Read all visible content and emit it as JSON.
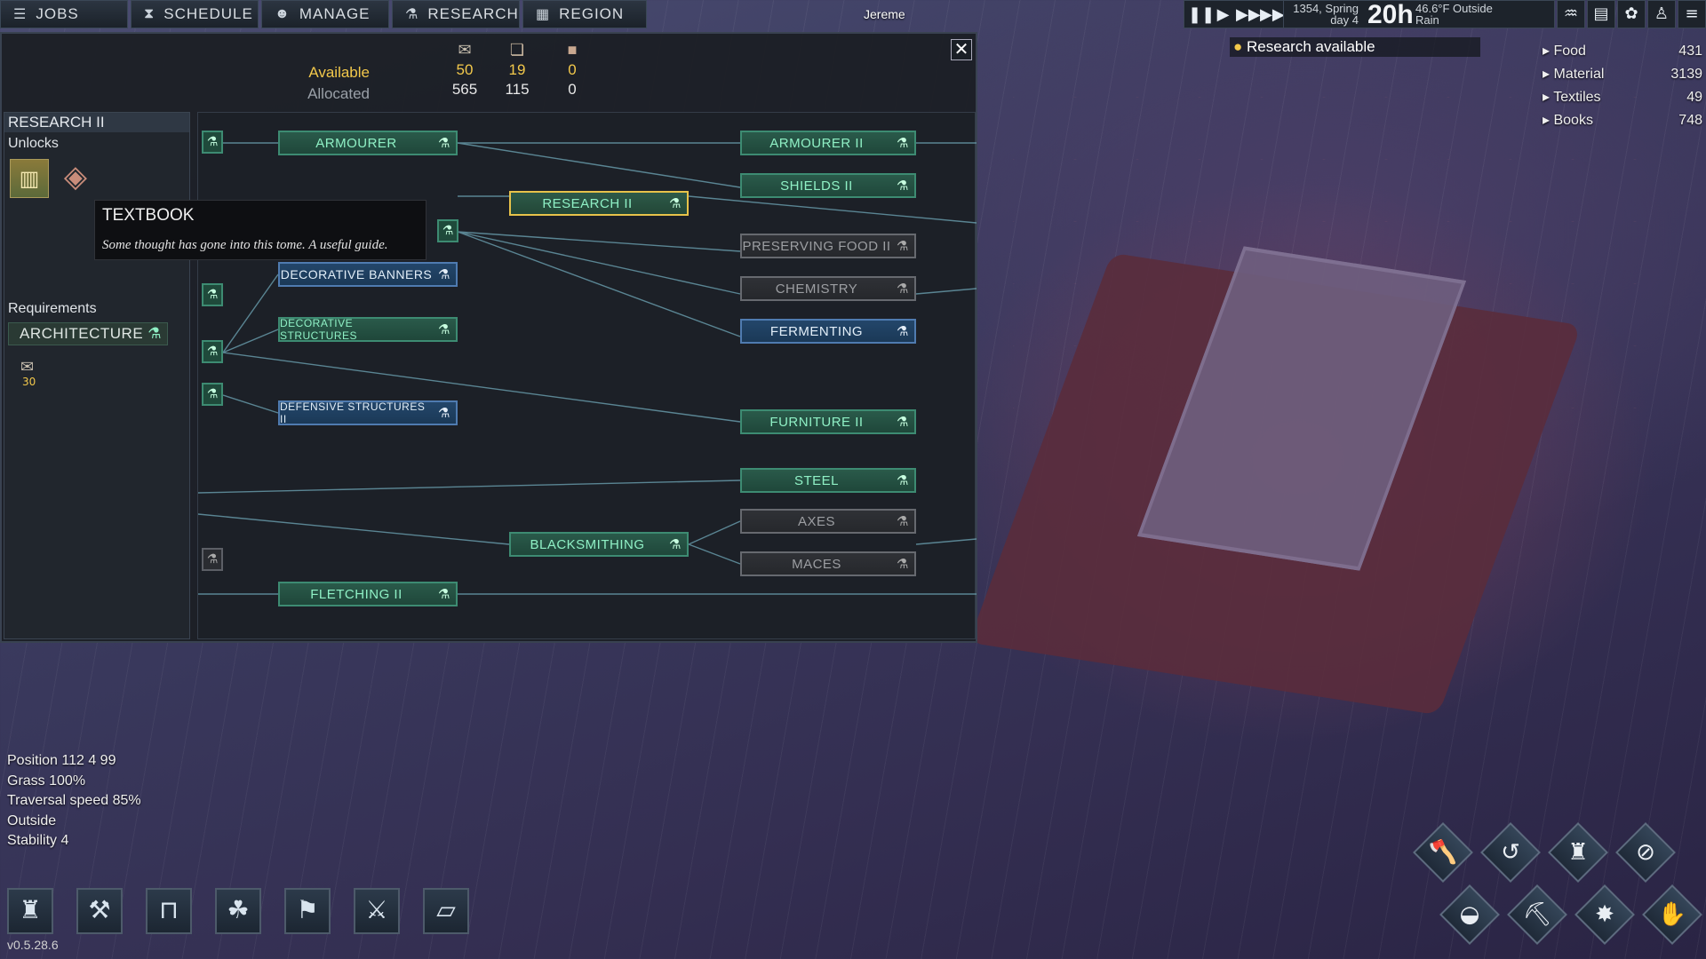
{
  "topbar": {
    "tabs": [
      {
        "label": "JOBS",
        "icon": "list-icon"
      },
      {
        "label": "SCHEDULE",
        "icon": "hourglass-icon"
      },
      {
        "label": "MANAGE",
        "icon": "people-icon"
      },
      {
        "label": "RESEARCH",
        "icon": "flask-icon"
      },
      {
        "label": "REGION",
        "icon": "map-icon"
      }
    ]
  },
  "worker_label": "Jereme",
  "time": {
    "controls": [
      "pause-icon",
      "play-icon",
      "fast-forward-icon",
      "fastest-icon"
    ],
    "date_line1": "1354, Spring",
    "date_line2": "day 4",
    "hour": "20h",
    "temp": "46.6°F Outside",
    "weather": "Rain"
  },
  "notice": {
    "bullet": "●",
    "text": "Research available"
  },
  "stockpile": [
    {
      "name": "Food",
      "value": "431"
    },
    {
      "name": "Material",
      "value": "3139"
    },
    {
      "name": "Textiles",
      "value": "49"
    },
    {
      "name": "Books",
      "value": "748"
    }
  ],
  "research_panel": {
    "available_label": "Available",
    "allocated_label": "Allocated",
    "resources": [
      {
        "icon": "scroll-icon",
        "available": "50",
        "allocated": "565"
      },
      {
        "icon": "notebook-icon",
        "available": "19",
        "allocated": "115"
      },
      {
        "icon": "book-icon",
        "available": "0",
        "allocated": "0"
      }
    ],
    "selected": {
      "title": "RESEARCH II",
      "unlocks_label": "Unlocks",
      "requirements_label": "Requirements",
      "requirement": "ARCHITECTURE",
      "cost": "30"
    },
    "tooltip": {
      "title": "TEXTBOOK",
      "description": "Some thought has gone into this tome. A useful guide."
    },
    "nodes": {
      "armourer": "ARMOURER",
      "armourer_ii": "ARMOURER II",
      "shields_ii": "SHIELDS II",
      "research_ii": "RESEARCH II",
      "preserving_food_ii": "PRESERVING FOOD II",
      "chemistry": "CHEMISTRY",
      "fermenting": "FERMENTING",
      "decorative_banners": "DECORATIVE BANNERS",
      "decorative_structures": "DECORATIVE STRUCTURES",
      "defensive_structures_ii": "DEFENSIVE STRUCTURES II",
      "furniture_ii": "FURNITURE II",
      "steel": "STEEL",
      "blacksmithing": "BLACKSMITHING",
      "axes": "AXES",
      "maces": "MACES",
      "fletching_ii": "FLETCHING II"
    }
  },
  "info": {
    "position": "Position 112 4 99",
    "grass": "Grass 100%",
    "traversal": "Traversal speed 85%",
    "outside": "Outside",
    "stability": "Stability 4"
  },
  "version": "v0.5.28.6"
}
